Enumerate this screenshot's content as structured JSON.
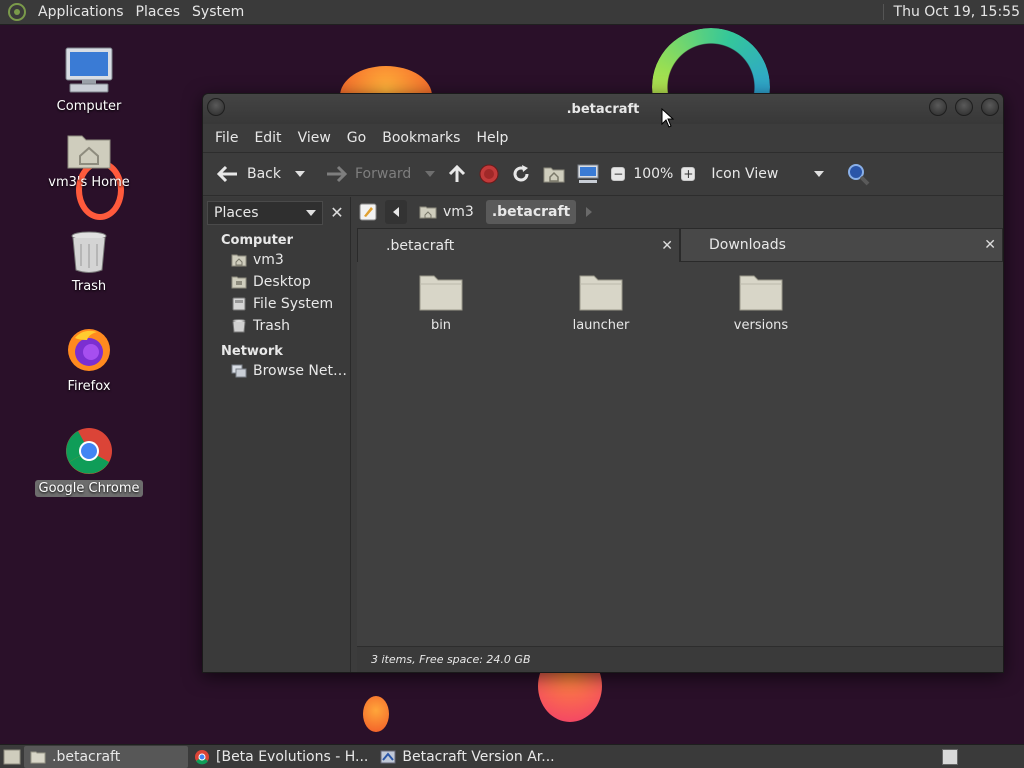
{
  "top_panel": {
    "menus": [
      "Applications",
      "Places",
      "System"
    ],
    "clock": "Thu Oct 19, 15:55"
  },
  "desktop": {
    "icons": [
      {
        "label": "Computer",
        "icon": "computer-icon"
      },
      {
        "label": "vm3's Home",
        "icon": "home-folder-icon"
      },
      {
        "label": "Trash",
        "icon": "trash-icon"
      },
      {
        "label": "Firefox",
        "icon": "firefox-icon"
      },
      {
        "label": "Google Chrome",
        "icon": "chrome-icon",
        "selected": true
      }
    ]
  },
  "window": {
    "title": ".betacraft",
    "menubar": [
      "File",
      "Edit",
      "View",
      "Go",
      "Bookmarks",
      "Help"
    ],
    "toolbar": {
      "back_label": "Back",
      "forward_label": "Forward",
      "zoom": "100%",
      "view_mode": "Icon View"
    },
    "sidebar": {
      "selector": "Places",
      "sections": [
        {
          "heading": "Computer",
          "items": [
            {
              "label": "vm3",
              "icon": "home-icon"
            },
            {
              "label": "Desktop",
              "icon": "desktop-icon"
            },
            {
              "label": "File System",
              "icon": "drive-icon"
            },
            {
              "label": "Trash",
              "icon": "trash-icon"
            }
          ]
        },
        {
          "heading": "Network",
          "items": [
            {
              "label": "Browse Net…",
              "icon": "network-icon"
            }
          ]
        }
      ]
    },
    "pathbar": {
      "crumbs": [
        "vm3",
        ".betacraft"
      ]
    },
    "tabs": [
      {
        "label": ".betacraft",
        "active": true
      },
      {
        "label": "Downloads",
        "active": false
      }
    ],
    "files": [
      {
        "name": "bin"
      },
      {
        "name": "launcher"
      },
      {
        "name": "versions"
      }
    ],
    "status": "3 items, Free space: 24.0 GB"
  },
  "taskbar": {
    "tasks": [
      {
        "label": ".betacraft",
        "icon": "folder-icon",
        "active": true
      },
      {
        "label": "[Beta Evolutions - H...",
        "icon": "chrome-icon",
        "active": false
      },
      {
        "label": "Betacraft Version Ar...",
        "icon": "app-icon",
        "active": false
      }
    ]
  },
  "colors": {
    "desktop_bg": "#2a1029",
    "panel_bg": "#3a3a3a",
    "window_bg": "#3c3c3c",
    "content_bg": "#404040",
    "folder": "#d8d6c8"
  }
}
